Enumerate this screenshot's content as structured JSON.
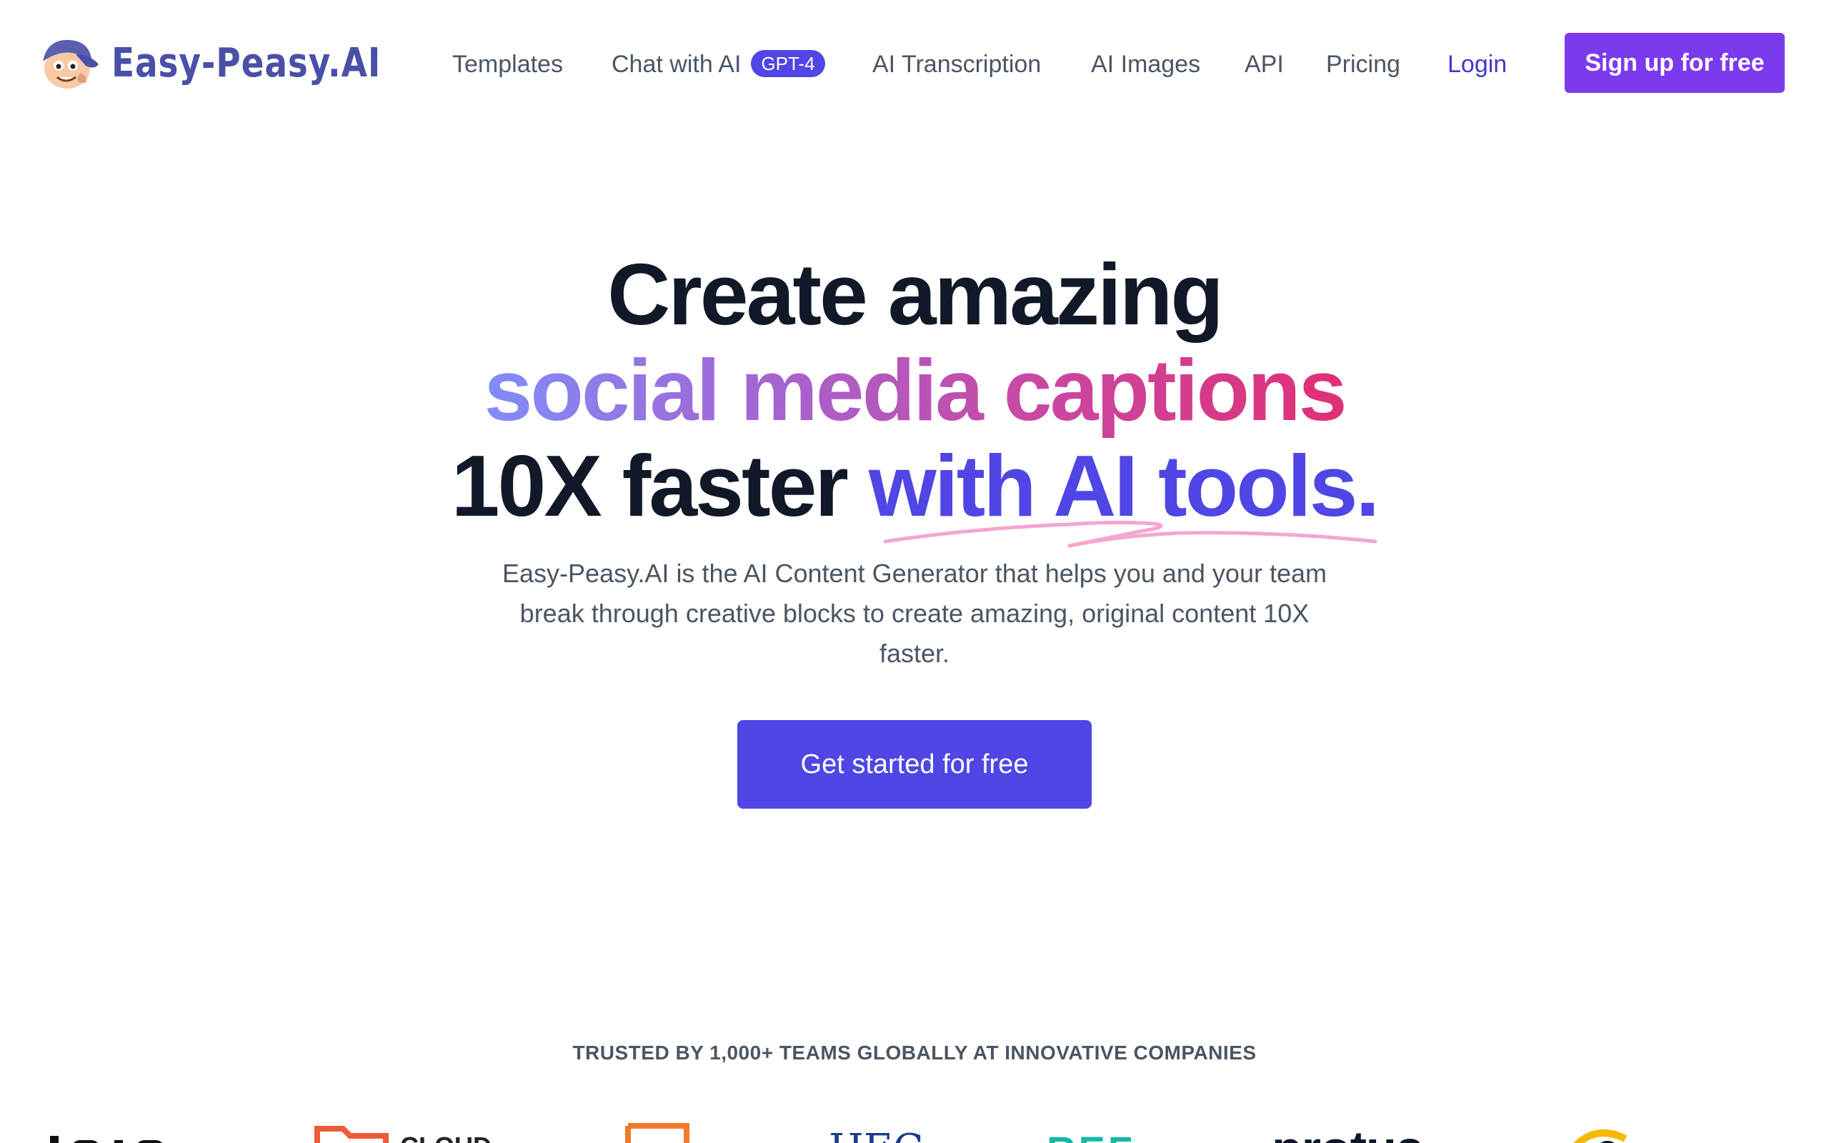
{
  "brand": {
    "name": "Easy-Peasy.AI"
  },
  "nav": {
    "templates": "Templates",
    "chat": "Chat with AI",
    "chat_badge": "GPT-4",
    "transcription": "AI Transcription",
    "images": "AI Images",
    "api": "API",
    "pricing": "Pricing",
    "login": "Login",
    "signup": "Sign up for free"
  },
  "hero": {
    "line1": "Create amazing",
    "line2": "social media captions",
    "line3_plain": "10X faster ",
    "line3_accent": "with AI tools.",
    "description": "Easy-Peasy.AI is the AI Content Generator that helps you and your team break through creative blocks to create amazing, original content 10X faster.",
    "cta": "Get started for free"
  },
  "trusted": {
    "heading": "TRUSTED BY 1,000+ TEAMS GLOBALLY AT INNOVATIVE COMPANIES",
    "logos": [
      "",
      "CLOUD",
      "",
      "HEC",
      "REF",
      "protus",
      ""
    ]
  },
  "colors": {
    "accent": "#4f46e5",
    "signup": "#7c3aed",
    "logo_text": "#4a4fa8",
    "nav_text": "#4b5563",
    "heading": "#111827",
    "gradient_start": "#818cf8",
    "gradient_end": "#e02f75",
    "underline": "#f3a6cf"
  }
}
